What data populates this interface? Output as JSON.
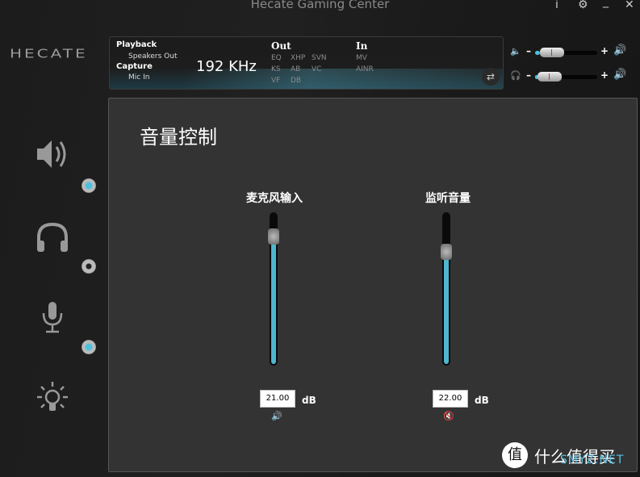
{
  "window": {
    "title": "Hecate Gaming Center",
    "info_label": "i",
    "settings_icon": "gear-icon",
    "minimize_label": "_",
    "close_label": "✕"
  },
  "logo": "HECATE",
  "status": {
    "playback_label": "Playback",
    "playback_device": "Speakers Out",
    "capture_label": "Capture",
    "capture_device": "Mic In",
    "sample_rate": "192  KHz",
    "out_label": "Out",
    "out_tags": [
      "EQ",
      "XHP",
      "SVN",
      "KS",
      "AB",
      "VC",
      "VF",
      "DB"
    ],
    "in_label": "In",
    "in_tags": [
      "MV",
      "AINR"
    ],
    "swap_icon": "swap-icon"
  },
  "master_volume": [
    {
      "device": "speaker",
      "minus": "–",
      "plus": "+",
      "level_pct": 8
    },
    {
      "device": "headphone",
      "minus": "–",
      "plus": "+",
      "level_pct": 5
    }
  ],
  "sidebar": [
    {
      "name": "speaker",
      "active": true
    },
    {
      "name": "headphone",
      "active": false
    },
    {
      "name": "microphone",
      "active": true
    },
    {
      "name": "lighting",
      "active": false
    }
  ],
  "panel": {
    "title": "音量控制",
    "channels": [
      {
        "label": "麦克风输入",
        "level_pct": 85,
        "value": "21.00",
        "unit": "dB",
        "muted": false,
        "mute_icon": "🔊"
      },
      {
        "label": "监听音量",
        "level_pct": 75,
        "value": "22.00",
        "unit": "dB",
        "muted": true,
        "mute_icon": "🔇"
      }
    ]
  },
  "watermark": {
    "badge": "值",
    "text": "什么值得买",
    "sub": "SMYZ.NET"
  }
}
